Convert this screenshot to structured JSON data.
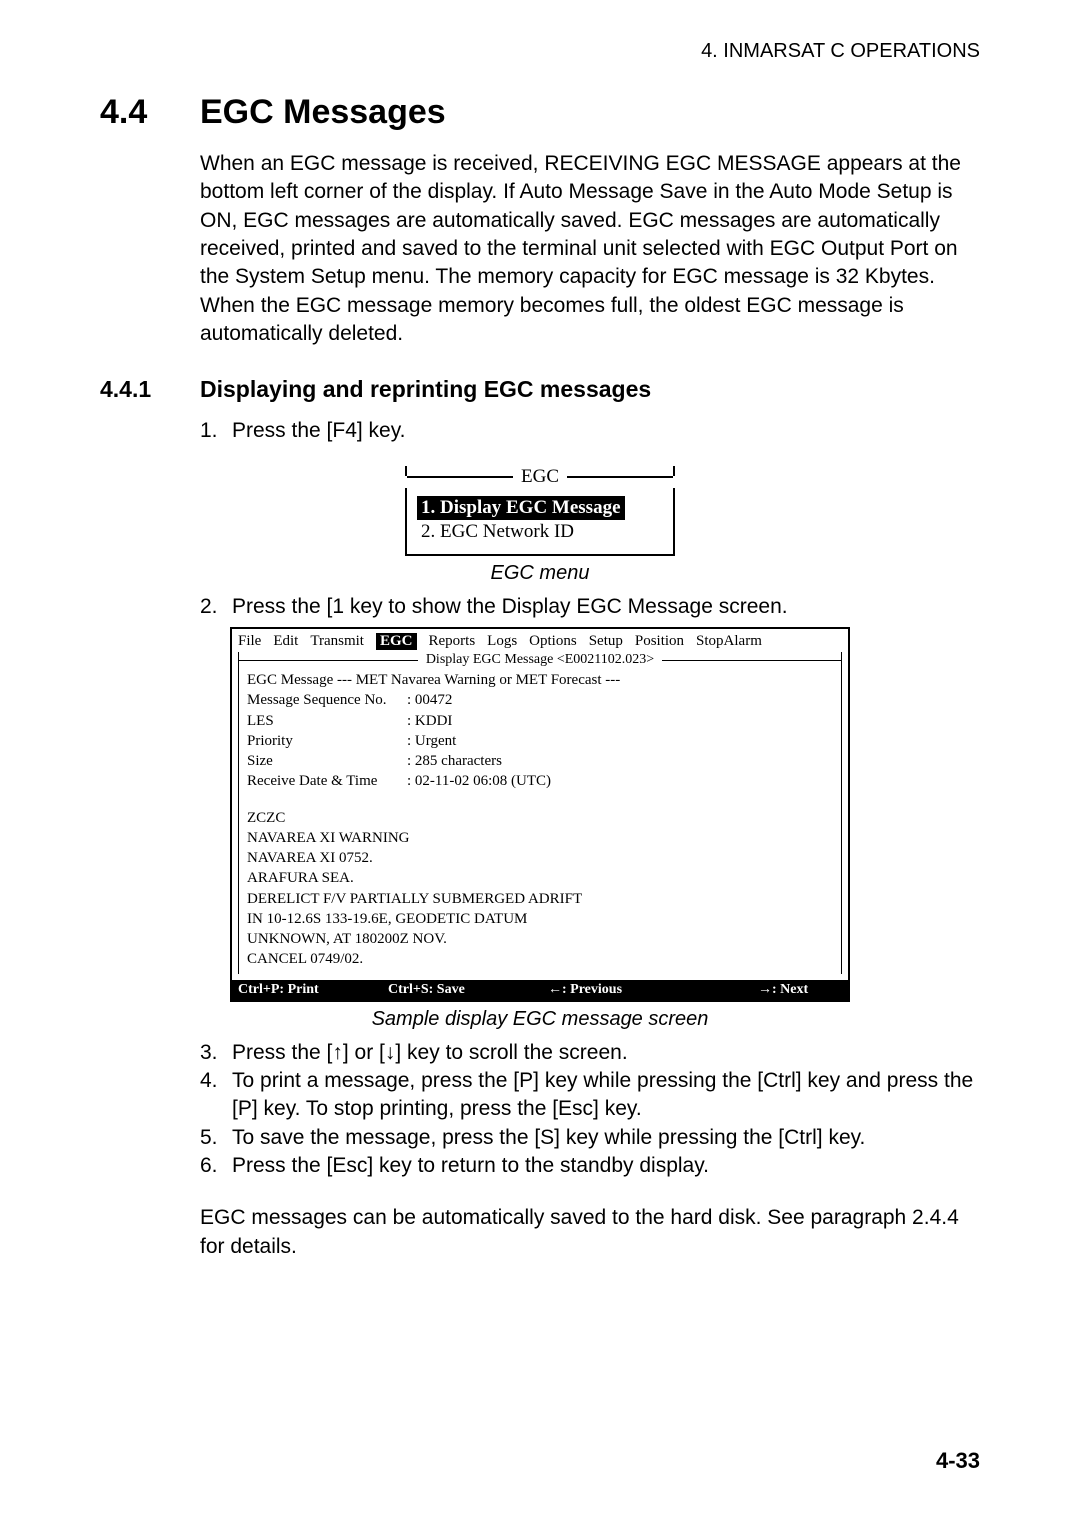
{
  "running_head": "4. INMARSAT C OPERATIONS",
  "h1": {
    "num": "4.4",
    "title": "EGC Messages"
  },
  "intro_para": "When an EGC message is received, RECEIVING EGC MESSAGE appears at the bottom left corner of the display. If Auto Message Save in the Auto Mode Setup is ON, EGC messages are automatically saved. EGC messages are automatically received, printed and saved to the terminal unit selected with EGC Output Port on the System Setup menu. The memory capacity for EGC message is 32 Kbytes. When the EGC message memory becomes full, the oldest EGC message is automatically deleted.",
  "h2": {
    "num": "4.4.1",
    "title": "Displaying and reprinting EGC messages"
  },
  "steps": {
    "s1": "Press the [F4] key.",
    "s2": "Press the [1 key to show the Display EGC Message screen.",
    "s3": "Press the [↑] or [↓] key to scroll the screen.",
    "s4": "To print a message, press the [P] key while pressing the [Ctrl] key and press the [P] key. To stop printing, press the [Esc] key.",
    "s5": "To save the message, press the [S] key while pressing the [Ctrl] key.",
    "s6": "Press the [Esc] key to return to the standby display."
  },
  "egc_menu": {
    "frame_label": "EGC",
    "item1": "1. Display EGC Message",
    "item2": "2. EGC Network ID",
    "caption": "EGC menu"
  },
  "screen": {
    "menubar": [
      "File",
      "Edit",
      "Transmit",
      "EGC",
      "Reports",
      "Logs",
      "Options",
      "Setup",
      "Position",
      "StopAlarm"
    ],
    "selected_menu_index": 3,
    "panel_title": " Display EGC Message <E0021102.023> ",
    "header_line": "EGC Message  --- MET Navarea Warning or MET Forecast ---",
    "kv": {
      "msg_seq_k": "Message Sequence No.",
      "msg_seq_v": "00472",
      "les_k": "LES",
      "les_v": "KDDI",
      "priority_k": "Priority",
      "priority_v": "Urgent",
      "size_k": "Size",
      "size_v": "285 characters",
      "recv_k": "Receive Date & Time",
      "recv_v": "02-11-02  06:08  (UTC)"
    },
    "body_lines": [
      "ZCZC",
      "NAVAREA XI WARNING",
      "NAVAREA XI  0752.",
      "ARAFURA SEA.",
      "DERELICT F/V PARTIALLY SUBMERGED ADRIFT",
      "IN 10-12.6S 133-19.6E, GEODETIC DATUM",
      "UNKNOWN, AT 180200Z NOV.",
      "CANCEL 0749/02."
    ],
    "footer": {
      "print": "Ctrl+P: Print",
      "save": "Ctrl+S: Save",
      "prev": "←: Previous",
      "next": "→: Next"
    },
    "caption": "Sample display EGC message screen"
  },
  "closing_para": "EGC messages can be automatically saved to the hard disk. See paragraph 2.4.4 for details.",
  "page_number": "4-33"
}
